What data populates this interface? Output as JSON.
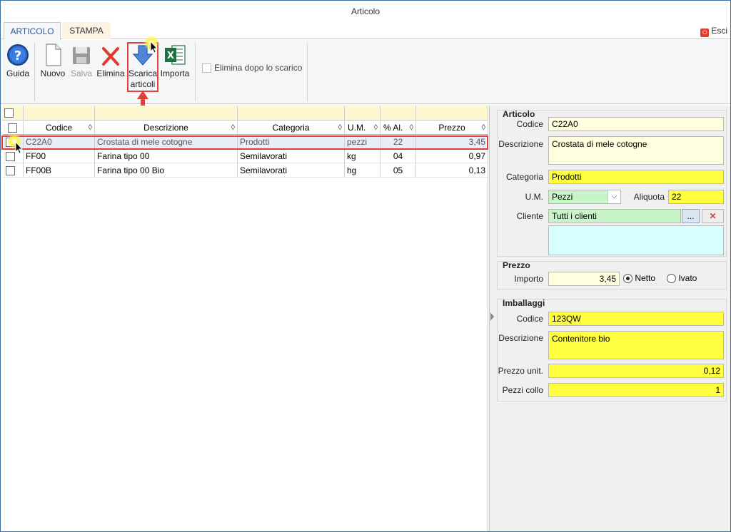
{
  "window": {
    "title": "Articolo"
  },
  "tabs": [
    {
      "label": "ARTICOLO"
    },
    {
      "label": "STAMPA"
    }
  ],
  "exit_label": "Esci",
  "ribbon": {
    "guida": "Guida",
    "nuovo": "Nuovo",
    "salva": "Salva",
    "elimina": "Elimina",
    "scarica_1": "Scarica",
    "scarica_2": "articoli",
    "importa": "Importa",
    "elimina_dopo": "Elimina dopo lo scarico"
  },
  "grid": {
    "columns": [
      "Codice",
      "Descrizione",
      "Categoria",
      "U.M.",
      "% Al.",
      "Prezzo"
    ],
    "rows": [
      {
        "codice": "C22A0",
        "descrizione": "Crostata di mele cotogne",
        "categoria": "Prodotti",
        "um": "pezzi",
        "al": "22",
        "prezzo": "3,45"
      },
      {
        "codice": "FF00",
        "descrizione": "Farina tipo 00",
        "categoria": "Semilavorati",
        "um": "kg",
        "al": "04",
        "prezzo": "0,97"
      },
      {
        "codice": "FF00B",
        "descrizione": "Farina tipo 00 Bio",
        "categoria": "Semilavorati",
        "um": "hg",
        "al": "05",
        "prezzo": "0,13"
      }
    ]
  },
  "articolo": {
    "title": "Articolo",
    "codice_label": "Codice",
    "codice": "C22A0",
    "descrizione_label": "Descrizione",
    "descrizione": "Crostata di mele cotogne",
    "categoria_label": "Categoria",
    "categoria": "Prodotti",
    "um_label": "U.M.",
    "um": "Pezzi",
    "aliquota_label": "Aliquota",
    "aliquota": "22",
    "cliente_label": "Cliente",
    "cliente": "Tutti i clienti",
    "cliente_btn": "..."
  },
  "prezzo": {
    "title": "Prezzo",
    "importo_label": "Importo",
    "importo": "3,45",
    "netto": "Netto",
    "ivato": "Ivato"
  },
  "imballaggi": {
    "title": "Imballaggi",
    "codice_label": "Codice",
    "codice": "123QW",
    "descrizione_label": "Descrizione",
    "descrizione": "Contenitore bio",
    "prezzo_label": "Prezzo unit.",
    "prezzo": "0,12",
    "pezzi_label": "Pezzi collo",
    "pezzi": "1"
  },
  "colors": {
    "accent": "#2a5ea0",
    "highlight": "#e0403a",
    "required": "#ffff40",
    "optional": "#ffffe0"
  }
}
